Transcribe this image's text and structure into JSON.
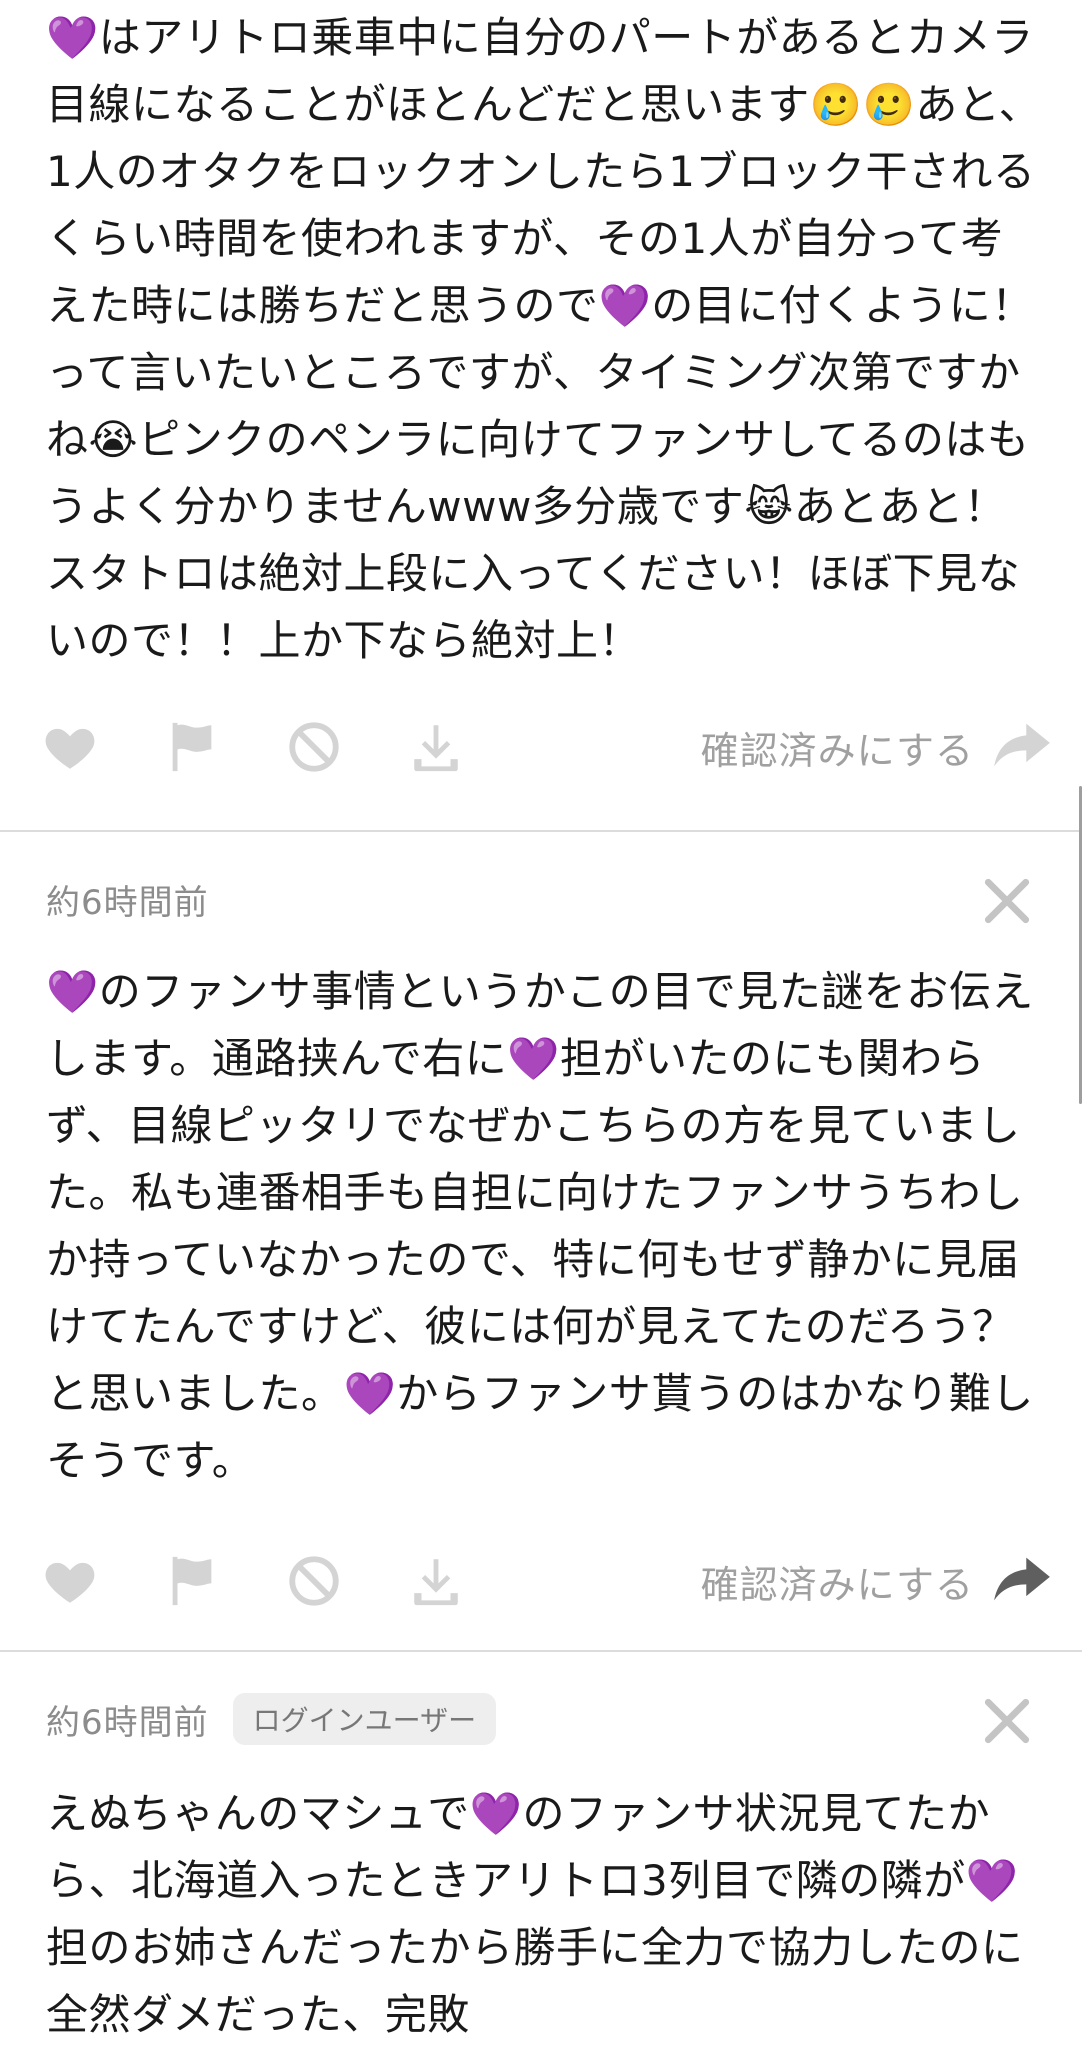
{
  "cards": [
    {
      "time": "",
      "body": "💜はアリトロ乗車中に自分のパートがあるとカメラ目線になることがほとんどだと思います🥲🥲あと、1人のオタクをロックオンしたら1ブロック干されるくらい時間を使われますが、その1人が自分って考えた時には勝ちだと思うので💜の目に付くように！って言いたいところですが、タイミング次第ですかね😭ピンクのペンラに向けてファンサしてるのはもうよく分かりませんwww多分歳です😹あとあと！スタトロは絶対上段に入ってください！ほぼ下見ないので！！上か下なら絶対上！",
      "confirm_label": "確認済みにする"
    },
    {
      "time": "約6時間前",
      "body": "💜のファンサ事情というかこの目で見た謎をお伝えします。通路挟んで右に💜担がいたのにも関わらず、目線ピッタリでなぜかこちらの方を見ていました。私も連番相手も自担に向けたファンサうちわしか持っていなかったので、特に何もせず静かに見届けてたんですけど、彼には何が見えてたのだろう？と思いました。💜からファンサ貰うのはかなり難しそうです。",
      "confirm_label": "確認済みにする"
    },
    {
      "time": "約6時間前",
      "badge": "ログインユーザー",
      "body": "えぬちゃんのマシュで💜のファンサ状況見てたから、北海道入ったときアリトロ3列目で隣の隣が💜担のお姉さんだったから勝手に全力で協力したのに全然ダメだった、完敗"
    }
  ],
  "icons": {
    "like": "heart-icon",
    "report": "flag-icon",
    "block": "block-icon",
    "save": "download-icon",
    "confirm": "share-arrow-icon",
    "close": "close-icon"
  },
  "colors": {
    "icon_gray": "#d4d4d4",
    "confirm_text": "#a0a0a0",
    "share_active": "#5f5f5f",
    "divider": "#dcdcdc"
  }
}
